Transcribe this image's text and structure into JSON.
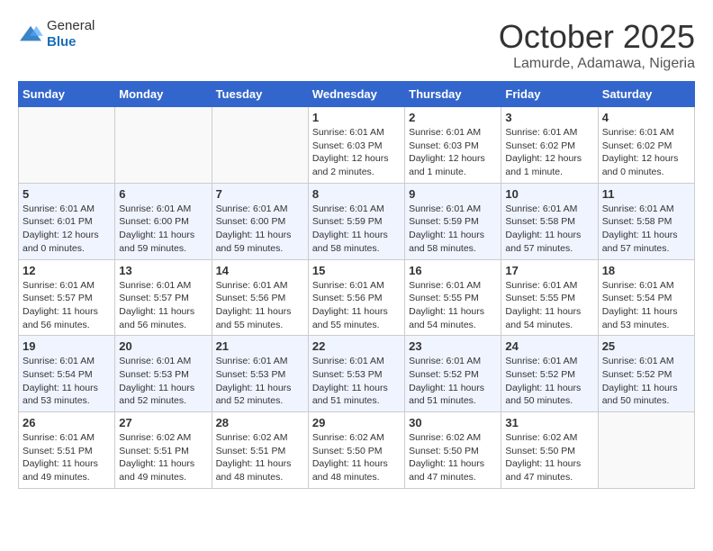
{
  "header": {
    "logo_general": "General",
    "logo_blue": "Blue",
    "month": "October 2025",
    "location": "Lamurde, Adamawa, Nigeria"
  },
  "weekdays": [
    "Sunday",
    "Monday",
    "Tuesday",
    "Wednesday",
    "Thursday",
    "Friday",
    "Saturday"
  ],
  "weeks": [
    [
      {
        "day": "",
        "info": ""
      },
      {
        "day": "",
        "info": ""
      },
      {
        "day": "",
        "info": ""
      },
      {
        "day": "1",
        "info": "Sunrise: 6:01 AM\nSunset: 6:03 PM\nDaylight: 12 hours\nand 2 minutes."
      },
      {
        "day": "2",
        "info": "Sunrise: 6:01 AM\nSunset: 6:03 PM\nDaylight: 12 hours\nand 1 minute."
      },
      {
        "day": "3",
        "info": "Sunrise: 6:01 AM\nSunset: 6:02 PM\nDaylight: 12 hours\nand 1 minute."
      },
      {
        "day": "4",
        "info": "Sunrise: 6:01 AM\nSunset: 6:02 PM\nDaylight: 12 hours\nand 0 minutes."
      }
    ],
    [
      {
        "day": "5",
        "info": "Sunrise: 6:01 AM\nSunset: 6:01 PM\nDaylight: 12 hours\nand 0 minutes."
      },
      {
        "day": "6",
        "info": "Sunrise: 6:01 AM\nSunset: 6:00 PM\nDaylight: 11 hours\nand 59 minutes."
      },
      {
        "day": "7",
        "info": "Sunrise: 6:01 AM\nSunset: 6:00 PM\nDaylight: 11 hours\nand 59 minutes."
      },
      {
        "day": "8",
        "info": "Sunrise: 6:01 AM\nSunset: 5:59 PM\nDaylight: 11 hours\nand 58 minutes."
      },
      {
        "day": "9",
        "info": "Sunrise: 6:01 AM\nSunset: 5:59 PM\nDaylight: 11 hours\nand 58 minutes."
      },
      {
        "day": "10",
        "info": "Sunrise: 6:01 AM\nSunset: 5:58 PM\nDaylight: 11 hours\nand 57 minutes."
      },
      {
        "day": "11",
        "info": "Sunrise: 6:01 AM\nSunset: 5:58 PM\nDaylight: 11 hours\nand 57 minutes."
      }
    ],
    [
      {
        "day": "12",
        "info": "Sunrise: 6:01 AM\nSunset: 5:57 PM\nDaylight: 11 hours\nand 56 minutes."
      },
      {
        "day": "13",
        "info": "Sunrise: 6:01 AM\nSunset: 5:57 PM\nDaylight: 11 hours\nand 56 minutes."
      },
      {
        "day": "14",
        "info": "Sunrise: 6:01 AM\nSunset: 5:56 PM\nDaylight: 11 hours\nand 55 minutes."
      },
      {
        "day": "15",
        "info": "Sunrise: 6:01 AM\nSunset: 5:56 PM\nDaylight: 11 hours\nand 55 minutes."
      },
      {
        "day": "16",
        "info": "Sunrise: 6:01 AM\nSunset: 5:55 PM\nDaylight: 11 hours\nand 54 minutes."
      },
      {
        "day": "17",
        "info": "Sunrise: 6:01 AM\nSunset: 5:55 PM\nDaylight: 11 hours\nand 54 minutes."
      },
      {
        "day": "18",
        "info": "Sunrise: 6:01 AM\nSunset: 5:54 PM\nDaylight: 11 hours\nand 53 minutes."
      }
    ],
    [
      {
        "day": "19",
        "info": "Sunrise: 6:01 AM\nSunset: 5:54 PM\nDaylight: 11 hours\nand 53 minutes."
      },
      {
        "day": "20",
        "info": "Sunrise: 6:01 AM\nSunset: 5:53 PM\nDaylight: 11 hours\nand 52 minutes."
      },
      {
        "day": "21",
        "info": "Sunrise: 6:01 AM\nSunset: 5:53 PM\nDaylight: 11 hours\nand 52 minutes."
      },
      {
        "day": "22",
        "info": "Sunrise: 6:01 AM\nSunset: 5:53 PM\nDaylight: 11 hours\nand 51 minutes."
      },
      {
        "day": "23",
        "info": "Sunrise: 6:01 AM\nSunset: 5:52 PM\nDaylight: 11 hours\nand 51 minutes."
      },
      {
        "day": "24",
        "info": "Sunrise: 6:01 AM\nSunset: 5:52 PM\nDaylight: 11 hours\nand 50 minutes."
      },
      {
        "day": "25",
        "info": "Sunrise: 6:01 AM\nSunset: 5:52 PM\nDaylight: 11 hours\nand 50 minutes."
      }
    ],
    [
      {
        "day": "26",
        "info": "Sunrise: 6:01 AM\nSunset: 5:51 PM\nDaylight: 11 hours\nand 49 minutes."
      },
      {
        "day": "27",
        "info": "Sunrise: 6:02 AM\nSunset: 5:51 PM\nDaylight: 11 hours\nand 49 minutes."
      },
      {
        "day": "28",
        "info": "Sunrise: 6:02 AM\nSunset: 5:51 PM\nDaylight: 11 hours\nand 48 minutes."
      },
      {
        "day": "29",
        "info": "Sunrise: 6:02 AM\nSunset: 5:50 PM\nDaylight: 11 hours\nand 48 minutes."
      },
      {
        "day": "30",
        "info": "Sunrise: 6:02 AM\nSunset: 5:50 PM\nDaylight: 11 hours\nand 47 minutes."
      },
      {
        "day": "31",
        "info": "Sunrise: 6:02 AM\nSunset: 5:50 PM\nDaylight: 11 hours\nand 47 minutes."
      },
      {
        "day": "",
        "info": ""
      }
    ]
  ]
}
